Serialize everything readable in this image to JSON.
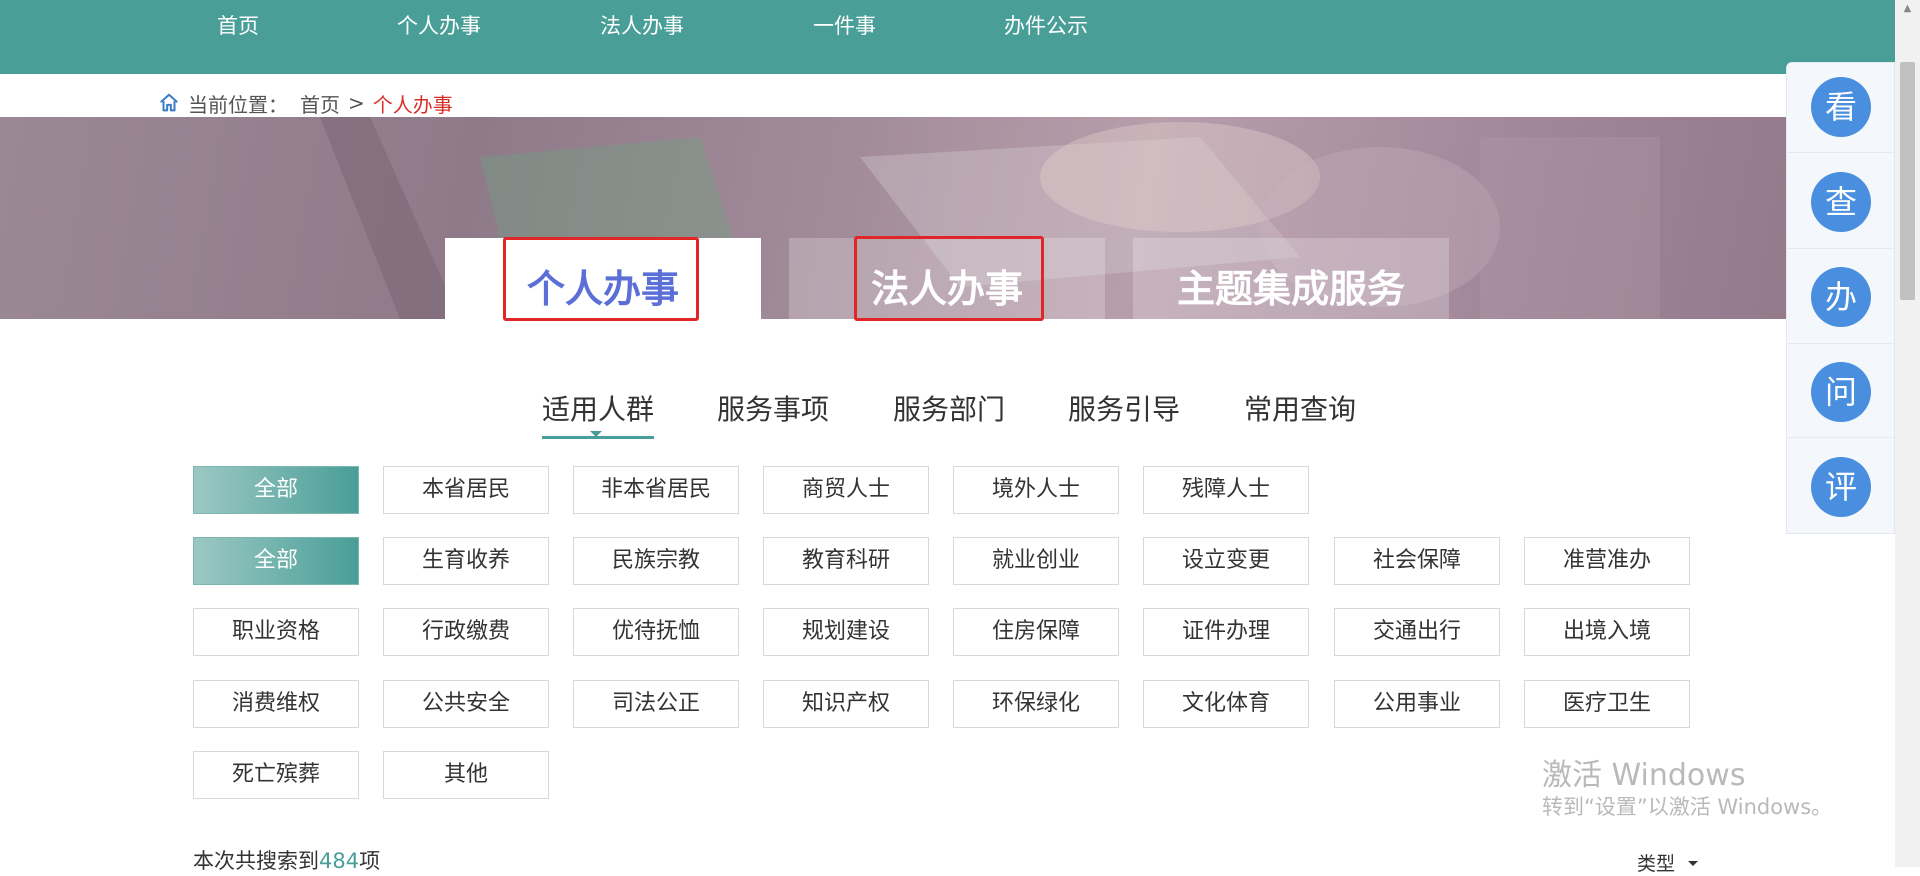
{
  "nav": {
    "items": [
      "首页",
      "个人办事",
      "法人办事",
      "一件事",
      "办件公示"
    ]
  },
  "breadcrumb": {
    "label": "当前位置：",
    "home": "首页",
    "sep": ">",
    "current": "个人办事"
  },
  "main_tabs": [
    "个人办事",
    "法人办事",
    "主题集成服务"
  ],
  "sub_tabs": [
    "适用人群",
    "服务事项",
    "服务部门",
    "服务引导",
    "常用查询"
  ],
  "audience_chips": [
    "全部",
    "本省居民",
    "非本省居民",
    "商贸人士",
    "境外人士",
    "残障人士"
  ],
  "topic_chips": [
    "全部",
    "生育收养",
    "民族宗教",
    "教育科研",
    "就业创业",
    "设立变更",
    "社会保障",
    "准营准办",
    "职业资格",
    "行政缴费",
    "优待抚恤",
    "规划建设",
    "住房保障",
    "证件办理",
    "交通出行",
    "出境入境",
    "消费维权",
    "公共安全",
    "司法公正",
    "知识产权",
    "环保绿化",
    "文化体育",
    "公用事业",
    "医疗卫生",
    "死亡殡葬",
    "其他"
  ],
  "float_buttons": [
    "看",
    "查",
    "办",
    "问",
    "评"
  ],
  "watermark": {
    "line1": "激活 Windows",
    "line2": "转到“设置”以激活 Windows。"
  },
  "results": {
    "prefix": "本次共搜索到",
    "count": "484",
    "suffix": "项"
  },
  "sort": {
    "label": "类型"
  },
  "colors": {
    "nav_bg": "#4a9e98",
    "accent": "#4a9e98",
    "active_tab_text": "#5b6fd6",
    "highlight_red": "#e02626",
    "float_btn": "#4a8fdf"
  }
}
